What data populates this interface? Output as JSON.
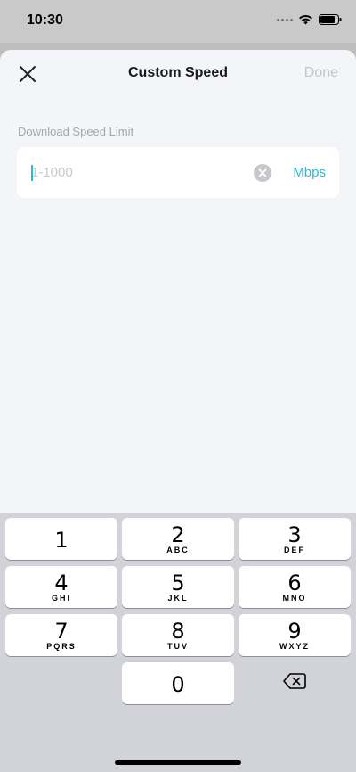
{
  "status_bar": {
    "time": "10:30"
  },
  "header": {
    "title": "Custom Speed",
    "done_label": "Done"
  },
  "form": {
    "label": "Download Speed Limit",
    "placeholder": "1-1000",
    "value": "",
    "unit": "Mbps"
  },
  "keypad": {
    "keys": [
      {
        "digit": "1",
        "letters": ""
      },
      {
        "digit": "2",
        "letters": "ABC"
      },
      {
        "digit": "3",
        "letters": "DEF"
      },
      {
        "digit": "4",
        "letters": "GHI"
      },
      {
        "digit": "5",
        "letters": "JKL"
      },
      {
        "digit": "6",
        "letters": "MNO"
      },
      {
        "digit": "7",
        "letters": "PQRS"
      },
      {
        "digit": "8",
        "letters": "TUV"
      },
      {
        "digit": "9",
        "letters": "WXYZ"
      },
      {
        "digit": "0",
        "letters": ""
      }
    ]
  },
  "colors": {
    "accent": "#2bbbd0",
    "disabled_text": "#c4c5c9",
    "sheet_background": "#f4f5f9",
    "keyboard_background": "#d1d3d9"
  },
  "icons": {
    "close": "close-icon",
    "clear": "clear-circle-icon",
    "backspace": "backspace-icon",
    "wifi": "wifi-icon",
    "battery": "battery-icon",
    "signal": "cellular-signal-icon"
  }
}
